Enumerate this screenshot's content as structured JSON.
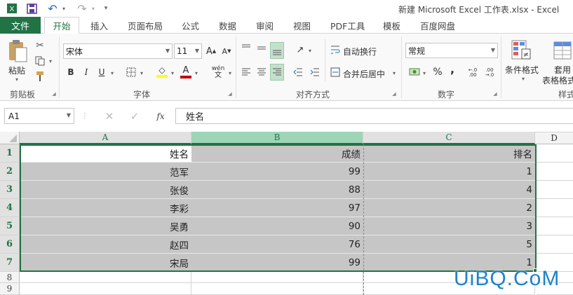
{
  "window": {
    "title": "新建 Microsoft Excel 工作表.xlsx - Excel"
  },
  "quick_access": {
    "save_icon": "save-icon",
    "undo_icon": "undo-icon",
    "redo_icon": "redo-icon",
    "customize_icon": "customize-qat-icon"
  },
  "tabs": [
    {
      "label": "文件"
    },
    {
      "label": "开始"
    },
    {
      "label": "插入"
    },
    {
      "label": "页面布局"
    },
    {
      "label": "公式"
    },
    {
      "label": "数据"
    },
    {
      "label": "审阅"
    },
    {
      "label": "视图"
    },
    {
      "label": "PDF工具"
    },
    {
      "label": "模板"
    },
    {
      "label": "百度网盘"
    }
  ],
  "ribbon": {
    "clipboard": {
      "paste_label": "粘贴",
      "group_label": "剪贴板"
    },
    "font": {
      "font_name": "宋体",
      "font_size": "11",
      "bold": "B",
      "italic": "I",
      "underline": "U",
      "phonetic": "wén",
      "group_label": "字体",
      "fill_color": "#ffff00",
      "font_color": "#c00000"
    },
    "alignment": {
      "wrap_label": "自动换行",
      "merge_label": "合并后居中",
      "group_label": "对齐方式"
    },
    "number": {
      "format": "常规",
      "percent": "%",
      "comma": ",",
      "group_label": "数字"
    },
    "styles": {
      "conditional_label": "条件格式",
      "table_label_1": "套用",
      "table_label_2": "表格格式",
      "group_label": "样式"
    }
  },
  "formula_bar": {
    "name_box": "A1",
    "fx": "fx",
    "content": "姓名"
  },
  "sheet": {
    "columns": [
      "A",
      "B",
      "C",
      "D"
    ],
    "rows": [
      {
        "num": "1",
        "a": "姓名",
        "b": "成绩",
        "c": "排名"
      },
      {
        "num": "2",
        "a": "范军",
        "b": "99",
        "c": "1"
      },
      {
        "num": "3",
        "a": "张俊",
        "b": "88",
        "c": "4"
      },
      {
        "num": "4",
        "a": "李彩",
        "b": "97",
        "c": "2"
      },
      {
        "num": "5",
        "a": "吴勇",
        "b": "90",
        "c": "3"
      },
      {
        "num": "6",
        "a": "赵四",
        "b": "76",
        "c": "5"
      },
      {
        "num": "7",
        "a": "宋局",
        "b": "99",
        "c": "1"
      },
      {
        "num": "8",
        "a": "",
        "b": "",
        "c": ""
      },
      {
        "num": "9",
        "a": "",
        "b": "",
        "c": ""
      }
    ],
    "selection_color": "#217346"
  },
  "watermark": "UiBQ.CoM"
}
